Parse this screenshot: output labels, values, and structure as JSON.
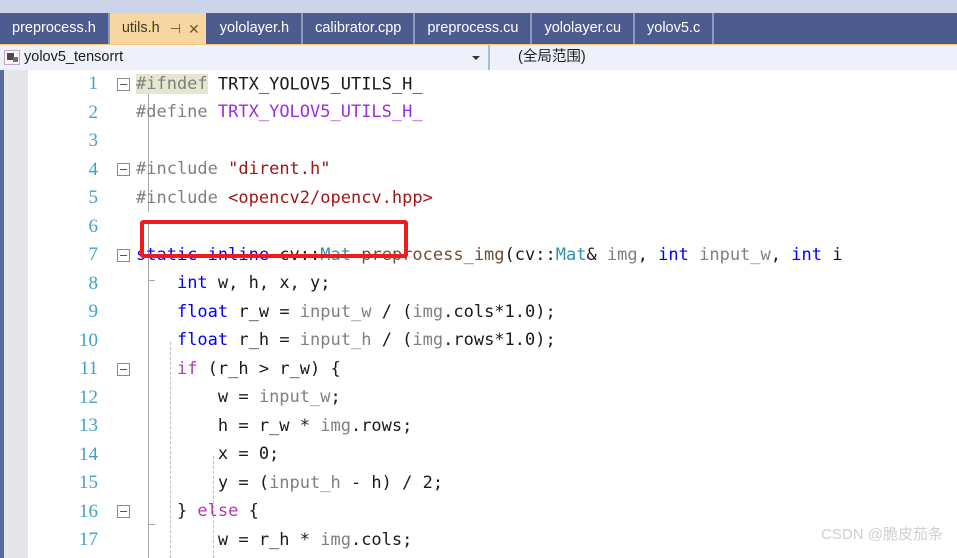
{
  "window": {
    "app": "Visual Studio",
    "watermark": "CSDN @脆皮茄条"
  },
  "tabs": [
    {
      "label": "preprocess.h",
      "active": false
    },
    {
      "label": "utils.h",
      "active": true,
      "pin_icon": "pin-icon",
      "close_icon": "close-icon",
      "pin_glyph": "⊣",
      "close_glyph": "✕"
    },
    {
      "label": "yololayer.h",
      "active": false
    },
    {
      "label": "calibrator.cpp",
      "active": false
    },
    {
      "label": "preprocess.cu",
      "active": false
    },
    {
      "label": "yololayer.cu",
      "active": false
    },
    {
      "label": "yolov5.c",
      "active": false
    }
  ],
  "navbar": {
    "project_icon": "project-icon",
    "project": "yolov5_tensorrt",
    "project_caret": "chevron-down-icon",
    "scope": "(全局范围)"
  },
  "editor": {
    "annotation": {
      "shape": "rectangle",
      "color": "#ee1c1c",
      "target_line": 4
    },
    "lines": [
      {
        "no": "1",
        "fold": "collapse",
        "caret": true,
        "tokens": [
          {
            "t": "#ifndef",
            "c": "s-pp hl-ref"
          },
          {
            "t": " ",
            "c": "s-plain"
          },
          {
            "t": "TRTX_YOLOV5_UTILS_H_",
            "c": "s-plain"
          }
        ]
      },
      {
        "no": "2",
        "fold": "none",
        "tokens": [
          {
            "t": "#define",
            "c": "s-pp"
          },
          {
            "t": " ",
            "c": "s-plain"
          },
          {
            "t": "TRTX_YOLOV5_UTILS_H_",
            "c": "s-macro"
          }
        ]
      },
      {
        "no": "3",
        "fold": "none",
        "tokens": []
      },
      {
        "no": "4",
        "fold": "collapse",
        "tokens": [
          {
            "t": "#include",
            "c": "s-pp"
          },
          {
            "t": " ",
            "c": "s-plain"
          },
          {
            "t": "\"dirent.h\"",
            "c": "s-str"
          }
        ]
      },
      {
        "no": "5",
        "fold": "none",
        "tokens": [
          {
            "t": "#include",
            "c": "s-pp"
          },
          {
            "t": " ",
            "c": "s-plain"
          },
          {
            "t": "<opencv2/opencv.hpp>",
            "c": "s-str"
          }
        ]
      },
      {
        "no": "6",
        "fold": "none",
        "tokens": []
      },
      {
        "no": "7",
        "fold": "collapse",
        "tokens": [
          {
            "t": "static inline",
            "c": "s-kw"
          },
          {
            "t": " ",
            "c": "s-plain"
          },
          {
            "t": "cv::",
            "c": "s-plain"
          },
          {
            "t": "Mat",
            "c": "s-type"
          },
          {
            "t": " ",
            "c": "s-plain"
          },
          {
            "t": "preprocess_img",
            "c": "s-fn"
          },
          {
            "t": "(",
            "c": "s-plain"
          },
          {
            "t": "cv::",
            "c": "s-plain"
          },
          {
            "t": "Mat",
            "c": "s-type"
          },
          {
            "t": "& ",
            "c": "s-plain"
          },
          {
            "t": "img",
            "c": "s-ident"
          },
          {
            "t": ", ",
            "c": "s-plain"
          },
          {
            "t": "int",
            "c": "s-kw"
          },
          {
            "t": " ",
            "c": "s-plain"
          },
          {
            "t": "input_w",
            "c": "s-ident"
          },
          {
            "t": ", ",
            "c": "s-plain"
          },
          {
            "t": "int",
            "c": "s-kw"
          },
          {
            "t": " i",
            "c": "s-plain"
          }
        ]
      },
      {
        "no": "8",
        "fold": "none",
        "tokens": [
          {
            "t": "    ",
            "c": "s-plain"
          },
          {
            "t": "int",
            "c": "s-kw"
          },
          {
            "t": " w, h, x, y;",
            "c": "s-plain"
          }
        ]
      },
      {
        "no": "9",
        "fold": "none",
        "tokens": [
          {
            "t": "    ",
            "c": "s-plain"
          },
          {
            "t": "float",
            "c": "s-kw"
          },
          {
            "t": " r_w = ",
            "c": "s-plain"
          },
          {
            "t": "input_w",
            "c": "s-ident"
          },
          {
            "t": " / (",
            "c": "s-plain"
          },
          {
            "t": "img",
            "c": "s-ident"
          },
          {
            "t": ".cols*1.0);",
            "c": "s-plain"
          }
        ]
      },
      {
        "no": "10",
        "fold": "none",
        "tokens": [
          {
            "t": "    ",
            "c": "s-plain"
          },
          {
            "t": "float",
            "c": "s-kw"
          },
          {
            "t": " r_h = ",
            "c": "s-plain"
          },
          {
            "t": "input_h",
            "c": "s-ident"
          },
          {
            "t": " / (",
            "c": "s-plain"
          },
          {
            "t": "img",
            "c": "s-ident"
          },
          {
            "t": ".rows*1.0);",
            "c": "s-plain"
          }
        ]
      },
      {
        "no": "11",
        "fold": "collapse",
        "tokens": [
          {
            "t": "    ",
            "c": "s-plain"
          },
          {
            "t": "if",
            "c": "s-ctrl"
          },
          {
            "t": " (r_h > r_w) {",
            "c": "s-plain"
          }
        ]
      },
      {
        "no": "12",
        "fold": "none",
        "tokens": [
          {
            "t": "        w = ",
            "c": "s-plain"
          },
          {
            "t": "input_w",
            "c": "s-ident"
          },
          {
            "t": ";",
            "c": "s-plain"
          }
        ]
      },
      {
        "no": "13",
        "fold": "none",
        "tokens": [
          {
            "t": "        h = r_w * ",
            "c": "s-plain"
          },
          {
            "t": "img",
            "c": "s-ident"
          },
          {
            "t": ".rows;",
            "c": "s-plain"
          }
        ]
      },
      {
        "no": "14",
        "fold": "none",
        "tokens": [
          {
            "t": "        x = 0;",
            "c": "s-plain"
          }
        ]
      },
      {
        "no": "15",
        "fold": "none",
        "tokens": [
          {
            "t": "        y = (",
            "c": "s-plain"
          },
          {
            "t": "input_h",
            "c": "s-ident"
          },
          {
            "t": " - h) / 2;",
            "c": "s-plain"
          }
        ]
      },
      {
        "no": "16",
        "fold": "collapse",
        "tokens": [
          {
            "t": "    } ",
            "c": "s-plain"
          },
          {
            "t": "else",
            "c": "s-ctrl"
          },
          {
            "t": " {",
            "c": "s-plain"
          }
        ]
      },
      {
        "no": "17",
        "fold": "none",
        "tokens": [
          {
            "t": "        w = r_h * ",
            "c": "s-plain"
          },
          {
            "t": "img",
            "c": "s-ident"
          },
          {
            "t": ".cols;",
            "c": "s-plain"
          }
        ]
      }
    ]
  }
}
